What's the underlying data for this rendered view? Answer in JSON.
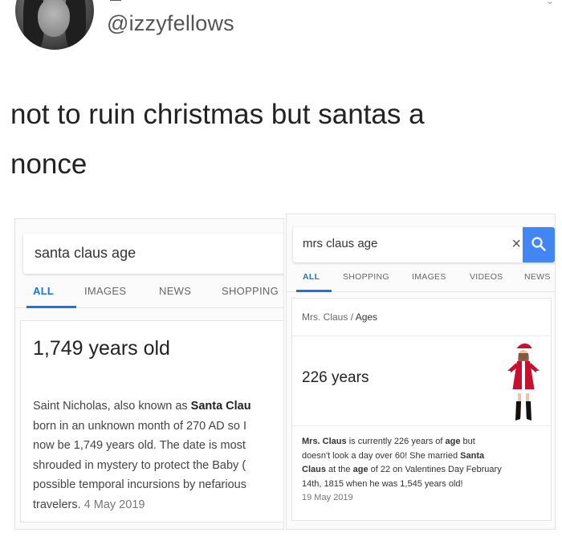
{
  "tweet": {
    "handle": "@izzyfellows",
    "text_line1": "not to ruin christmas but santas a",
    "text_line2": "nonce"
  },
  "left_result": {
    "query": "santa claus age",
    "tabs": [
      "ALL",
      "IMAGES",
      "NEWS",
      "SHOPPING"
    ],
    "active_tab": "ALL",
    "answer": "1,749 years old",
    "snippet_lines": [
      "Saint Nicholas, also known as ",
      "Santa Clau",
      "born in an unknown month of 270 AD so I",
      "now be 1,749 years old. The date is most",
      "shrouded in mystery to protect the Baby (",
      "possible temporal incursions by nefarious",
      "travelers."
    ],
    "date": "4 May 2019"
  },
  "right_result": {
    "query": "mrs claus age",
    "tabs": [
      "ALL",
      "SHOPPING",
      "IMAGES",
      "VIDEOS",
      "NEWS"
    ],
    "active_tab": "ALL",
    "breadcrumb_parent": "Mrs. Claus",
    "breadcrumb_sep": "/",
    "breadcrumb_current": "Ages",
    "answer": "226 years",
    "snippet": {
      "l1_bold": "Mrs. Claus",
      "l1_rest": " is currently 226 years of ",
      "l1_bold2": "age",
      "l1_end": " but",
      "l2": "doesn't look a day over 60! She married ",
      "l2_bold": "Santa",
      "l3_bold": "Claus",
      "l3_mid": " at the ",
      "l3_bold2": "age",
      "l3_end": " of 22 on Valentines Day February",
      "l4": "14th, 1815 when he was 1,545 years old!"
    },
    "date": "19 May 2019"
  },
  "colors": {
    "google_blue": "#1a73e8",
    "search_button": "#4285f4",
    "santa_red": "#c8102e"
  }
}
